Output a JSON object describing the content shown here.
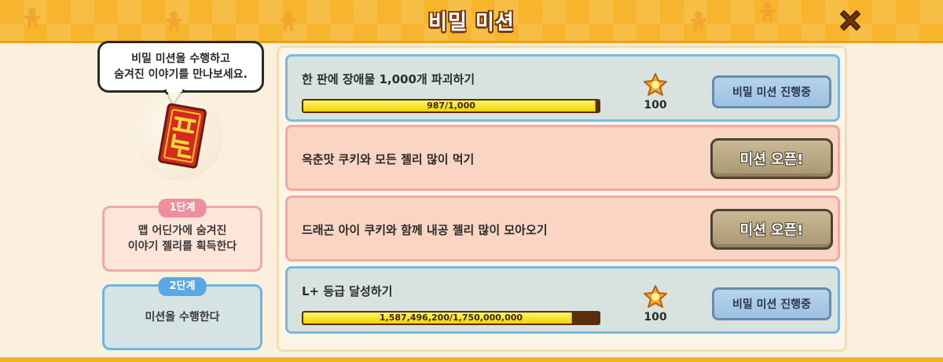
{
  "header": {
    "title": "비밀 미션"
  },
  "left_panel": {
    "bubble_lines": [
      "비밀 미션을 수행하고",
      "숨겨진 이야기를 만나보세요."
    ],
    "stages": [
      {
        "tab": "1단계",
        "lines": [
          "맵 어딘가에 숨겨진",
          "이야기 젤리를 획득한다"
        ]
      },
      {
        "tab": "2단계",
        "lines": [
          "미션을 수행한다"
        ]
      }
    ]
  },
  "missions": [
    {
      "title": "한 판에 장애물 1,000개 파괴하기",
      "state": "in_progress",
      "progress_text": "987/1,000",
      "progress_fraction": 0.987,
      "reward": "100",
      "button": "비밀 미션 진행중"
    },
    {
      "title": "옥춘맛 쿠키와 모든 젤리 많이 먹기",
      "state": "open",
      "button": "미션 오픈!"
    },
    {
      "title": "드래곤 아이 쿠키와 함께 내공 젤리 많이 모아오기",
      "state": "open",
      "button": "미션 오픈!"
    },
    {
      "title": "L+ 등급 달성하기",
      "state": "in_progress",
      "progress_text": "1,587,496,200/1,750,000,000",
      "progress_fraction": 0.907,
      "reward": "100",
      "button": "비밀 미션 진행중"
    }
  ],
  "colors": {
    "header": "#f6b52c",
    "title_outline": "#7a3d12",
    "bar_fill": "#f2d400",
    "bar_track": "#5a2d0c"
  }
}
